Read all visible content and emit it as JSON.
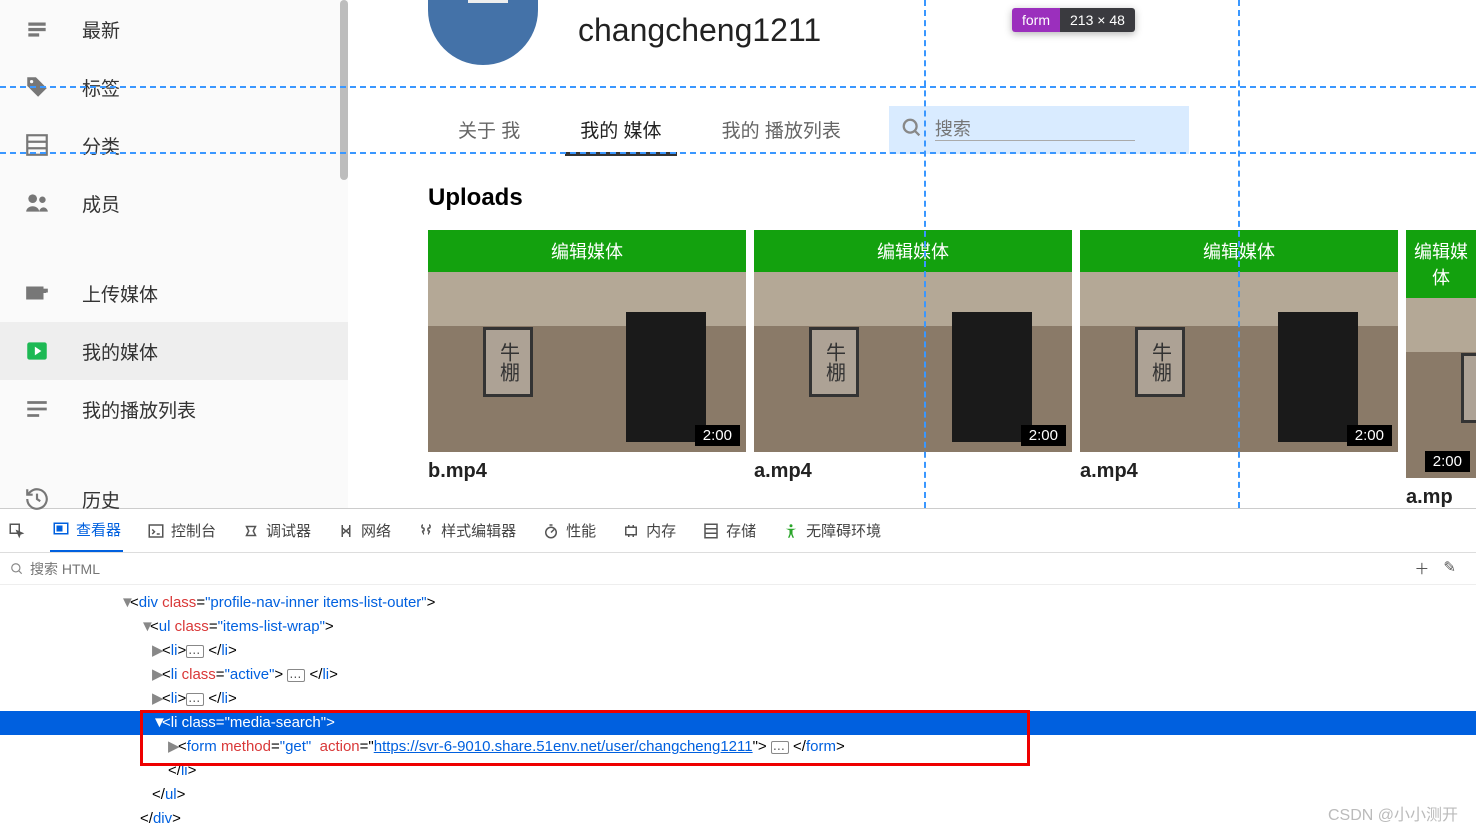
{
  "sidebar": {
    "items": [
      {
        "label": "最新",
        "icon": "clock"
      },
      {
        "label": "标签",
        "icon": "tag"
      },
      {
        "label": "分类",
        "icon": "list"
      },
      {
        "label": "成员",
        "icon": "people"
      },
      {
        "label": "上传媒体",
        "icon": "upload"
      },
      {
        "label": "我的媒体",
        "icon": "play",
        "active": true
      },
      {
        "label": "我的播放列表",
        "icon": "playlist"
      },
      {
        "label": "历史",
        "icon": "history"
      }
    ]
  },
  "profile": {
    "username": "changcheng1211",
    "tabs": [
      {
        "label": "关于 我"
      },
      {
        "label": "我的 媒体",
        "active": true
      },
      {
        "label": "我的 播放列表"
      }
    ],
    "search_placeholder": "搜索"
  },
  "inspector_badge": {
    "tag": "form",
    "dims": "213 × 48"
  },
  "uploads": {
    "title": "Uploads",
    "edit_label": "编辑媒体",
    "items": [
      {
        "name": "b.mp4",
        "duration": "2:00",
        "sign": "牛棚"
      },
      {
        "name": "a.mp4",
        "duration": "2:00",
        "sign": "牛棚"
      },
      {
        "name": "a.mp4",
        "duration": "2:00",
        "sign": "牛棚"
      },
      {
        "name": "a.mp",
        "duration": "2:00",
        "sign": "牛"
      }
    ]
  },
  "devtools": {
    "tabs": [
      "查看器",
      "控制台",
      "调试器",
      "网络",
      "样式编辑器",
      "性能",
      "内存",
      "存储",
      "无障碍环境"
    ],
    "search_placeholder": "搜索 HTML",
    "code": {
      "l1": {
        "pre": "▼",
        "open": "<div ",
        "cls": "class",
        "clsv": "profile-nav-inner items-list-outer",
        "close": ">"
      },
      "l2": {
        "pre": "▼",
        "open": "<ul ",
        "cls": "class",
        "clsv": "items-list-wrap",
        "close": ">"
      },
      "l3": {
        "pre": "▶",
        "open": "<li>",
        "close": " </li>"
      },
      "l4": {
        "pre": "▶",
        "open": "<li ",
        "cls": "class",
        "clsv": "active",
        "mid": "> ",
        "close": " </li>"
      },
      "l5": {
        "pre": "▶",
        "open": "<li>",
        "close": " </li>"
      },
      "l6": {
        "pre": "▼",
        "open": "<li ",
        "cls": "class",
        "clsv": "media-search",
        "close": ">"
      },
      "l7": {
        "pre": "▶",
        "open": "<form ",
        "m": "method",
        "mv": "get",
        "a": "action",
        "url": "https://svr-6-9010.share.51env.net/user/changcheng1211",
        "mid": "> ",
        "close": " </form>"
      },
      "l8": "</li>",
      "l9": "</ul>",
      "l10": "</div>"
    }
  },
  "watermark": "CSDN @小小测开"
}
